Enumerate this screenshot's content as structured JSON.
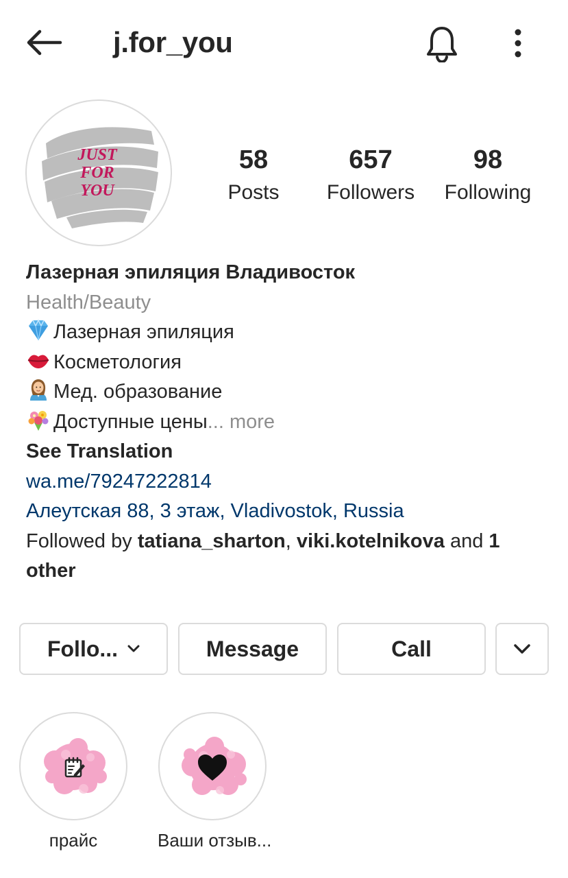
{
  "header": {
    "username": "j.for_you",
    "back_icon": "arrow-left-icon",
    "bell_icon": "bell-icon",
    "more_icon": "vertical-ellipsis-icon"
  },
  "avatar": {
    "logo_text": [
      "JUST",
      "FOR",
      "YOU"
    ],
    "brush_color": "#bdbdbd",
    "logo_text_color": "#c2185b"
  },
  "stats": [
    {
      "value": "58",
      "label": "Posts"
    },
    {
      "value": "657",
      "label": "Followers"
    },
    {
      "value": "98",
      "label": "Following"
    }
  ],
  "bio": {
    "name": "Лазерная эпиляция Владивосток",
    "category": "Health/Beauty",
    "lines": [
      {
        "icon": "diamond-emoji",
        "text": "Лазерная эпиляция"
      },
      {
        "icon": "lips-emoji",
        "text": "Косметология"
      },
      {
        "icon": "health-worker-emoji",
        "text": "Мед. образование"
      },
      {
        "icon": "bouquet-emoji",
        "text": "Доступные цены"
      }
    ],
    "ellipsis": "...",
    "more_label": "more",
    "see_translation": "See Translation",
    "link": "wa.me/79247222814",
    "address": "Алеутская 88, 3 этаж, Vladivostok, Russia",
    "followed_by": {
      "prefix": "Followed by",
      "user1": "tatiana_sharton",
      "separator": ",",
      "user2": "viki.kotelnikova",
      "connector": "and",
      "others": "1 other"
    }
  },
  "actions": {
    "follow_label": "Follo...",
    "message_label": "Message",
    "call_label": "Call",
    "chevron_icon": "chevron-down-icon"
  },
  "highlights": [
    {
      "label": "прайс",
      "icon": "notepad-pencil-icon",
      "bg_color": "#f4a6c8"
    },
    {
      "label": "Ваши отзыв...",
      "icon": "heart-icon",
      "bg_color": "#f4a6c8"
    }
  ],
  "colors": {
    "text": "#262626",
    "secondary": "#8e8e8e",
    "link": "#00376b",
    "border": "#dbdbdb"
  }
}
